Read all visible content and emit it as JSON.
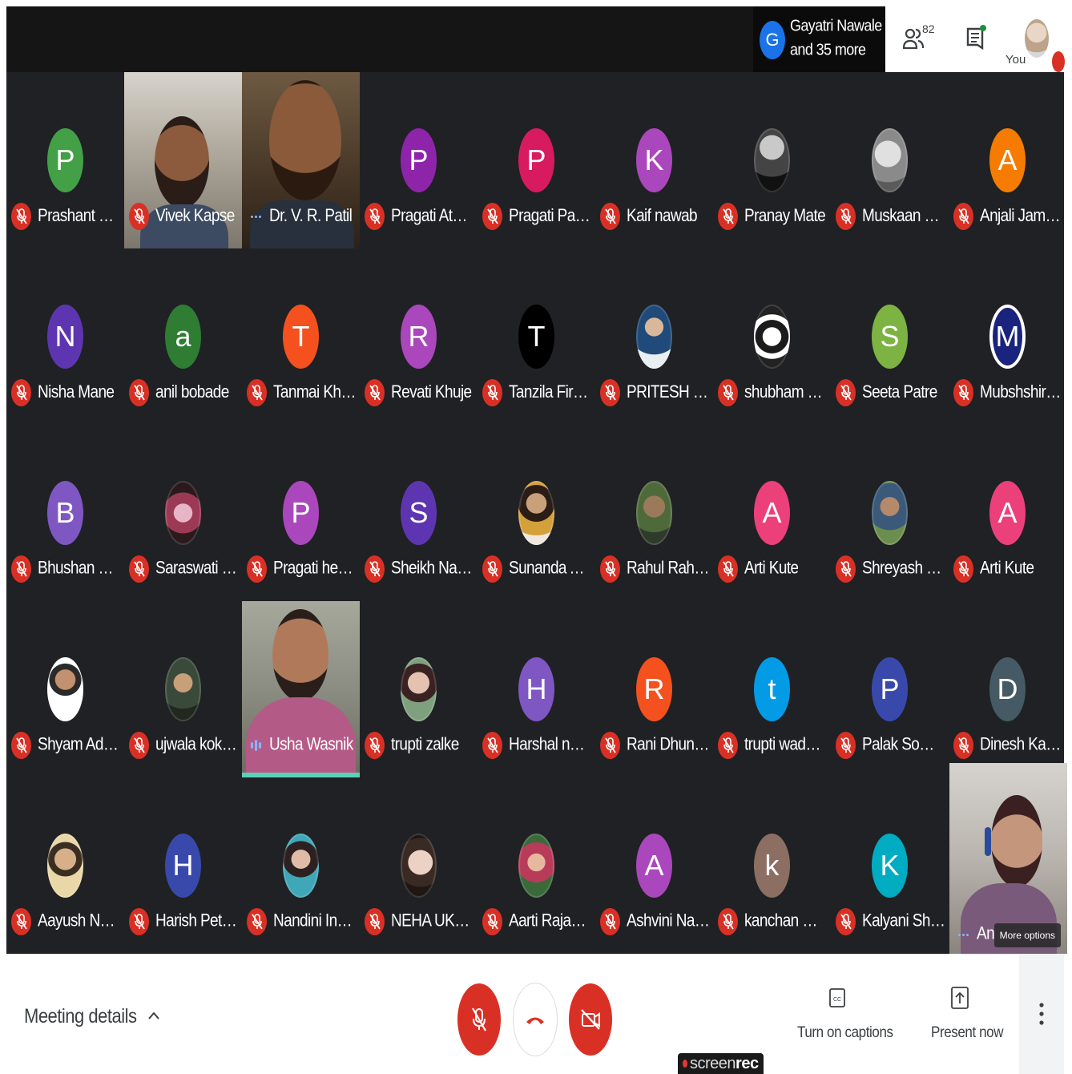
{
  "header": {
    "presenter_initial": "G",
    "presenter_line1": "Gayatri Nawale",
    "presenter_line2": "and 35 more",
    "participant_count": "82",
    "self_label": "You"
  },
  "participants": [
    {
      "name": "Prashant Gaw...",
      "initial": "P",
      "color": "#43a047",
      "kind": "letter",
      "mic": "muted"
    },
    {
      "name": "Vivek Kapse",
      "initial": "",
      "color": "",
      "kind": "video",
      "mic": "muted"
    },
    {
      "name": "Dr. V. R. Patil",
      "initial": "",
      "color": "",
      "kind": "video",
      "mic": "dots"
    },
    {
      "name": "Pragati Athole",
      "initial": "P",
      "color": "#8e24aa",
      "kind": "letter",
      "mic": "muted"
    },
    {
      "name": "Pragati Pagrut",
      "initial": "P",
      "color": "#d81b60",
      "kind": "letter",
      "mic": "muted"
    },
    {
      "name": "Kaif nawab",
      "initial": "K",
      "color": "#ab47bc",
      "kind": "letter",
      "mic": "muted"
    },
    {
      "name": "Pranay Mate",
      "initial": "",
      "color": "#3b3b3b",
      "kind": "photo",
      "mic": "muted"
    },
    {
      "name": "Muskaan Som...",
      "initial": "",
      "color": "#9e9e9e",
      "kind": "photo",
      "mic": "muted"
    },
    {
      "name": "Anjali Jambekar",
      "initial": "A",
      "color": "#f57c00",
      "kind": "letter",
      "mic": "muted"
    },
    {
      "name": "Nisha Mane",
      "initial": "N",
      "color": "#5e35b1",
      "kind": "letter",
      "mic": "muted"
    },
    {
      "name": "anil bobade",
      "initial": "a",
      "color": "#2e7d32",
      "kind": "letter",
      "mic": "muted"
    },
    {
      "name": "Tanmai Khand...",
      "initial": "T",
      "color": "#f4511e",
      "kind": "letter",
      "mic": "muted"
    },
    {
      "name": "Revati Khuje",
      "initial": "R",
      "color": "#ab47bc",
      "kind": "letter",
      "mic": "muted"
    },
    {
      "name": "Tanzila Firdos",
      "initial": "T",
      "color": "#000000",
      "kind": "letter",
      "mic": "muted"
    },
    {
      "name": "PRITESH UKE",
      "initial": "",
      "color": "#cfd8dc",
      "kind": "photo",
      "mic": "muted"
    },
    {
      "name": "shubham umale",
      "initial": "",
      "color": "#f5f5f5",
      "kind": "photo",
      "mic": "muted"
    },
    {
      "name": "Seeta Patre",
      "initial": "S",
      "color": "#7cb342",
      "kind": "letter",
      "mic": "muted"
    },
    {
      "name": "Mubshshireen...",
      "initial": "M",
      "color": "#1a237e",
      "kind": "letter",
      "mic": "muted"
    },
    {
      "name": "Bhushan Gaha...",
      "initial": "B",
      "color": "#7e57c2",
      "kind": "letter",
      "mic": "muted"
    },
    {
      "name": "Saraswati Morle",
      "initial": "",
      "color": "#6d2a3a",
      "kind": "photo",
      "mic": "muted"
    },
    {
      "name": "Pragati hekade",
      "initial": "P",
      "color": "#ab47bc",
      "kind": "letter",
      "mic": "muted"
    },
    {
      "name": "Sheikh Nadim",
      "initial": "S",
      "color": "#5e35b1",
      "kind": "letter",
      "mic": "muted"
    },
    {
      "name": "Sunanda Asw...",
      "initial": "",
      "color": "#c9a27e",
      "kind": "photo",
      "mic": "muted"
    },
    {
      "name": "Rahul Rahate",
      "initial": "",
      "color": "#7a6a4a",
      "kind": "photo",
      "mic": "muted"
    },
    {
      "name": "Arti Kute",
      "initial": "A",
      "color": "#ec407a",
      "kind": "letter",
      "mic": "muted"
    },
    {
      "name": "Shreyash Kavit...",
      "initial": "",
      "color": "#6b8e4e",
      "kind": "photo",
      "mic": "muted"
    },
    {
      "name": "Arti Kute",
      "initial": "A",
      "color": "#ec407a",
      "kind": "letter",
      "mic": "muted"
    },
    {
      "name": "Shyam Adhau",
      "initial": "",
      "color": "#f5f5f5",
      "kind": "photo",
      "mic": "muted"
    },
    {
      "name": "ujwala kokate",
      "initial": "",
      "color": "#6a5a3a",
      "kind": "photo",
      "mic": "muted"
    },
    {
      "name": "Usha Wasnik",
      "initial": "",
      "color": "",
      "kind": "video",
      "mic": "speaking"
    },
    {
      "name": "trupti zalke",
      "initial": "",
      "color": "#b07080",
      "kind": "photo",
      "mic": "muted"
    },
    {
      "name": "Harshal nande...",
      "initial": "H",
      "color": "#7e57c2",
      "kind": "letter",
      "mic": "muted"
    },
    {
      "name": "Rani Dhunde",
      "initial": "R",
      "color": "#f4511e",
      "kind": "letter",
      "mic": "muted"
    },
    {
      "name": "trupti wadatkar",
      "initial": "t",
      "color": "#039be5",
      "kind": "letter",
      "mic": "muted"
    },
    {
      "name": "Palak Somvan...",
      "initial": "P",
      "color": "#3949ab",
      "kind": "letter",
      "mic": "muted"
    },
    {
      "name": "Dinesh Kawade",
      "initial": "D",
      "color": "#455a64",
      "kind": "letter",
      "mic": "muted"
    },
    {
      "name": "Aayush Nawale",
      "initial": "",
      "color": "#c8a878",
      "kind": "photo",
      "mic": "muted"
    },
    {
      "name": "Harish Petkar",
      "initial": "H",
      "color": "#3949ab",
      "kind": "letter",
      "mic": "muted"
    },
    {
      "name": "Nandini Ingale",
      "initial": "",
      "color": "#4a8a9a",
      "kind": "photo",
      "mic": "muted"
    },
    {
      "name": "NEHA UKALK...",
      "initial": "",
      "color": "#e0c0b0",
      "kind": "photo",
      "mic": "muted"
    },
    {
      "name": "Aarti Rajankar",
      "initial": "",
      "color": "#9a5a4a",
      "kind": "photo",
      "mic": "muted"
    },
    {
      "name": "Ashvini Nandu...",
      "initial": "A",
      "color": "#ab47bc",
      "kind": "letter",
      "mic": "muted"
    },
    {
      "name": "kanchan Dhah...",
      "initial": "k",
      "color": "#8d6e63",
      "kind": "letter",
      "mic": "muted"
    },
    {
      "name": "Kalyani Sheng...",
      "initial": "K",
      "color": "#00acc1",
      "kind": "letter",
      "mic": "muted"
    }
  ],
  "last_tile": {
    "name": "An",
    "more_options_label": "More options"
  },
  "bottom": {
    "meeting_details_label": "Meeting details",
    "captions_label": "Turn on captions",
    "present_label": "Present now",
    "watermark_prefix": "screen",
    "watermark_suffix": "rec",
    "accent_red": "#d93025"
  }
}
